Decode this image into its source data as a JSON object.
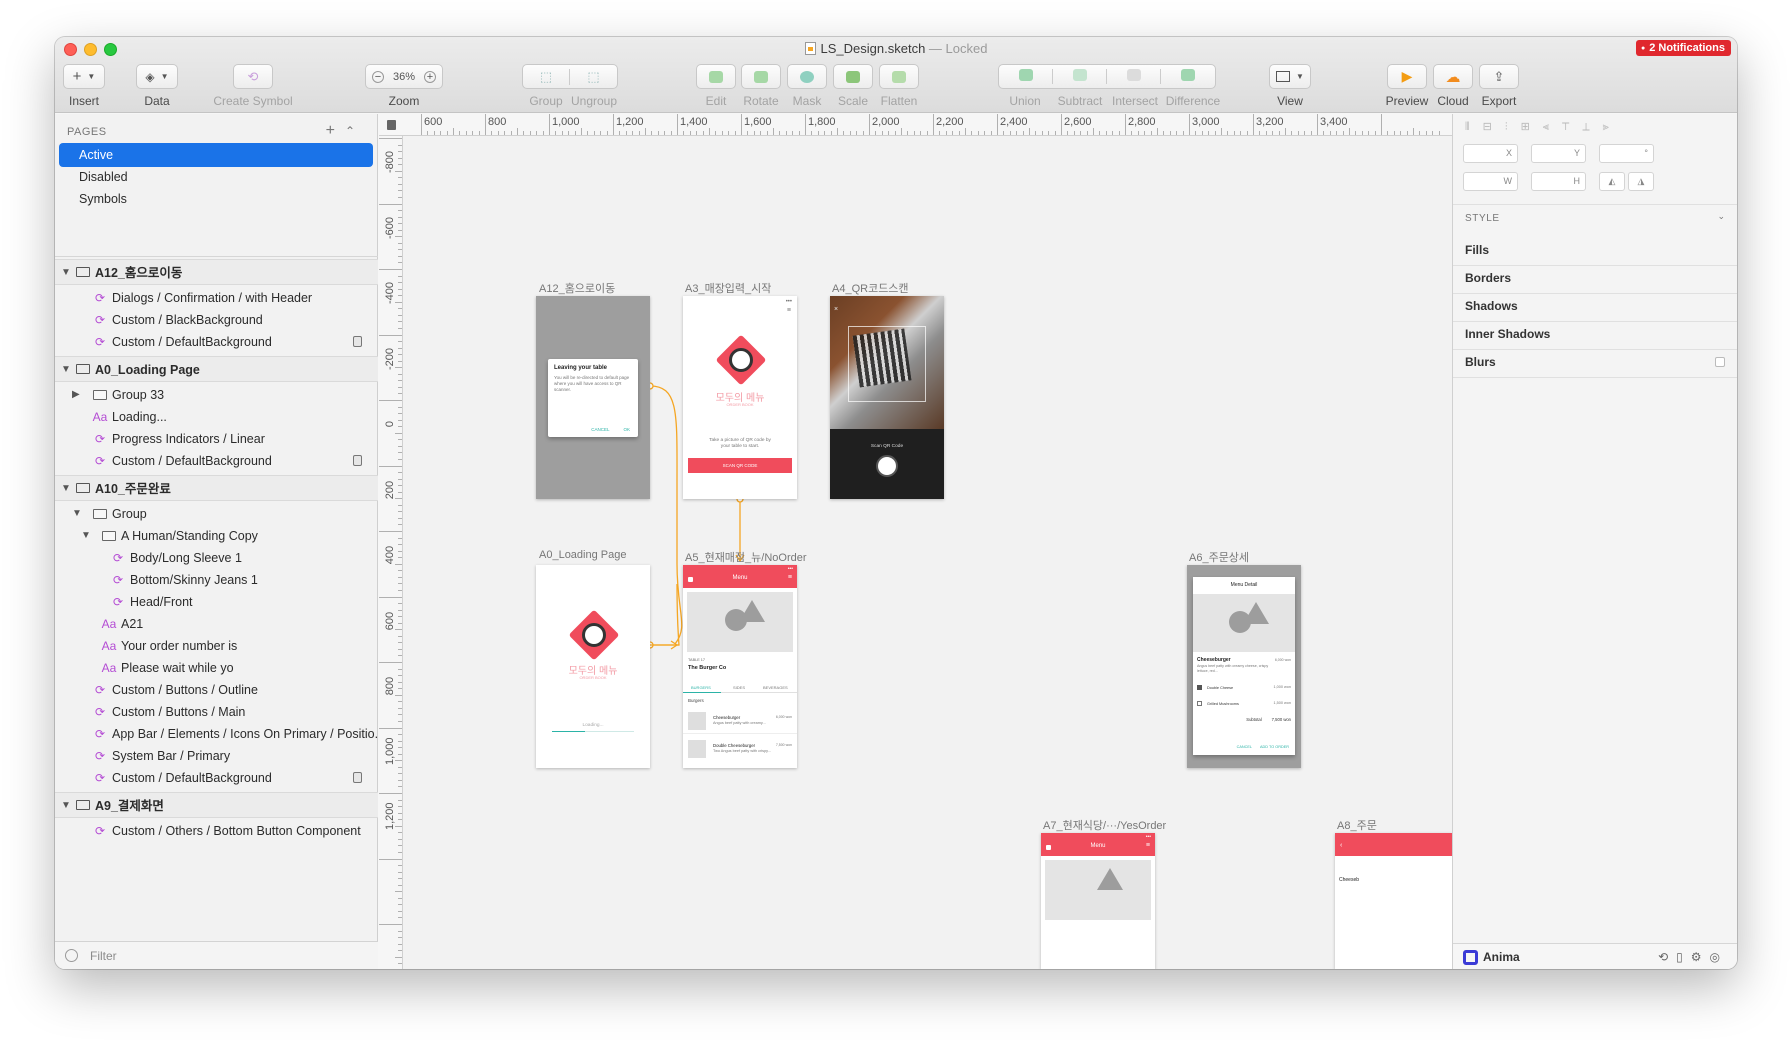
{
  "window": {
    "title": "LS_Design.sketch",
    "status": "— Locked",
    "notifications": "2 Notifications"
  },
  "toolbar": {
    "insert": "Insert",
    "data": "Data",
    "create_symbol": "Create Symbol",
    "zoom_value": "36%",
    "zoom": "Zoom",
    "group": "Group",
    "ungroup": "Ungroup",
    "edit": "Edit",
    "rotate": "Rotate",
    "mask": "Mask",
    "scale": "Scale",
    "flatten": "Flatten",
    "union": "Union",
    "subtract": "Subtract",
    "intersect": "Intersect",
    "difference": "Difference",
    "view": "View",
    "preview": "Preview",
    "cloud": "Cloud",
    "export": "Export"
  },
  "sidebar": {
    "pages_header": "PAGES",
    "pages": [
      "Active",
      "Disabled",
      "Symbols"
    ],
    "filter": "Filter",
    "layers": [
      {
        "kind": "artboard",
        "label": "A12_홈으로이동"
      },
      {
        "kind": "symbol",
        "label": "Dialogs / Confirmation / with Header"
      },
      {
        "kind": "symbol",
        "label": "Custom / BlackBackground"
      },
      {
        "kind": "symbol",
        "label": "Custom / DefaultBackground",
        "locked": true
      },
      {
        "kind": "artboard",
        "label": "A0_Loading Page"
      },
      {
        "kind": "group",
        "label": "Group 33"
      },
      {
        "kind": "text",
        "label": "Loading..."
      },
      {
        "kind": "symbol",
        "label": "Progress Indicators / Linear"
      },
      {
        "kind": "symbol",
        "label": "Custom / DefaultBackground",
        "locked": true
      },
      {
        "kind": "artboard",
        "label": "A10_주문완료"
      },
      {
        "kind": "group",
        "label": "Group"
      },
      {
        "kind": "group",
        "label": "A Human/Standing Copy"
      },
      {
        "kind": "symbol",
        "label": "Body/Long Sleeve 1"
      },
      {
        "kind": "symbol",
        "label": "Bottom/Skinny Jeans 1"
      },
      {
        "kind": "symbol",
        "label": "Head/Front"
      },
      {
        "kind": "text",
        "label": "A21"
      },
      {
        "kind": "text",
        "label": "Your order number is"
      },
      {
        "kind": "text",
        "label": "Please wait while yo"
      },
      {
        "kind": "symbol",
        "label": "Custom / Buttons / Outline"
      },
      {
        "kind": "symbol",
        "label": "Custom / Buttons / Main"
      },
      {
        "kind": "symbol",
        "label": "App Bar / Elements / Icons On Primary / Positio..."
      },
      {
        "kind": "symbol",
        "label": "System Bar / Primary"
      },
      {
        "kind": "symbol",
        "label": "Custom / DefaultBackground",
        "locked": true
      },
      {
        "kind": "artboard",
        "label": "A9_결제화면"
      },
      {
        "kind": "symbol",
        "label": "Custom / Others / Bottom Button Component"
      }
    ]
  },
  "ruler": {
    "h_labels": [
      "600",
      "800",
      "1,000",
      "1,200",
      "1,400",
      "1,600",
      "1,800",
      "2,000",
      "2,200",
      "2,400",
      "2,600",
      "2,800",
      "3,000",
      "3,200",
      "3,400"
    ],
    "v_labels": [
      "-800",
      "-600",
      "-400",
      "-200",
      "0",
      "200",
      "400",
      "600",
      "800",
      "1,000",
      "1,200"
    ]
  },
  "artboards": {
    "a12": {
      "title": "A12_홈으로이동",
      "dialog_title": "Leaving your table",
      "dialog_body": "You will be re-directed to default page where you will have access to QR scanner.",
      "cancel": "CANCEL",
      "ok": "OK"
    },
    "a3": {
      "title": "A3_매장입력_시작",
      "brand": "모두의 메뉴",
      "brand_sub": "ORDER BOOK",
      "instruction": "Take a picture of QR code by your table to start.",
      "button": "SCAN QR CODE"
    },
    "a4": {
      "title": "A4_QR코드스캔",
      "scan_label": "Scan QR Code"
    },
    "a0": {
      "title": "A0_Loading Page",
      "brand": "모두의 메뉴",
      "brand_sub": "ORDER BOOK",
      "loading": "Loading..."
    },
    "a5": {
      "title": "A5_현재매점_뉴/NoOrder",
      "appbar": "Menu",
      "table": "TABLE 17",
      "restaurant": "The Burger Co",
      "tabs": [
        "BURGERS",
        "SIDES",
        "BEVERAGES"
      ],
      "section": "Burgers",
      "items": [
        {
          "name": "Cheeseburger",
          "desc": "Angus beef patty with creamy...",
          "price": "6,000 won"
        },
        {
          "name": "Double Cheeseburger",
          "desc": "Two Angus beef patty with crispy...",
          "price": "7,500 won"
        }
      ]
    },
    "a6": {
      "title": "A6_주문상세",
      "header": "Menu Detail",
      "item": "Cheeseburger",
      "item_price": "6,000 won",
      "item_desc": "Angus beef patty with creamy cheese, crispy lettuce, red...",
      "options": [
        {
          "label": "Double Cheese",
          "price": "1,000 won",
          "checked": true
        },
        {
          "label": "Grilled Mushrooms",
          "price": "1,500 won",
          "checked": false
        }
      ],
      "subtotal_label": "Subtotal",
      "subtotal": "7,500 won",
      "cancel": "CANCEL",
      "add": "ADD TO ORDER"
    },
    "a7": {
      "title": "A7_현재식당/···/YesOrder",
      "appbar": "Menu"
    },
    "a8": {
      "title": "A8_주문",
      "item": "Cheeseb"
    }
  },
  "inspector": {
    "x": "X",
    "y": "Y",
    "rot": "°",
    "w": "W",
    "h": "H",
    "style": "STYLE",
    "sections": [
      "Fills",
      "Borders",
      "Shadows",
      "Inner Shadows",
      "Blurs"
    ],
    "plugin": "Anima"
  },
  "colors": {
    "accent": "#1a73e8",
    "brand_red": "#f04c5c",
    "flow": "#f5a623",
    "symbol": "#b44cd4"
  }
}
